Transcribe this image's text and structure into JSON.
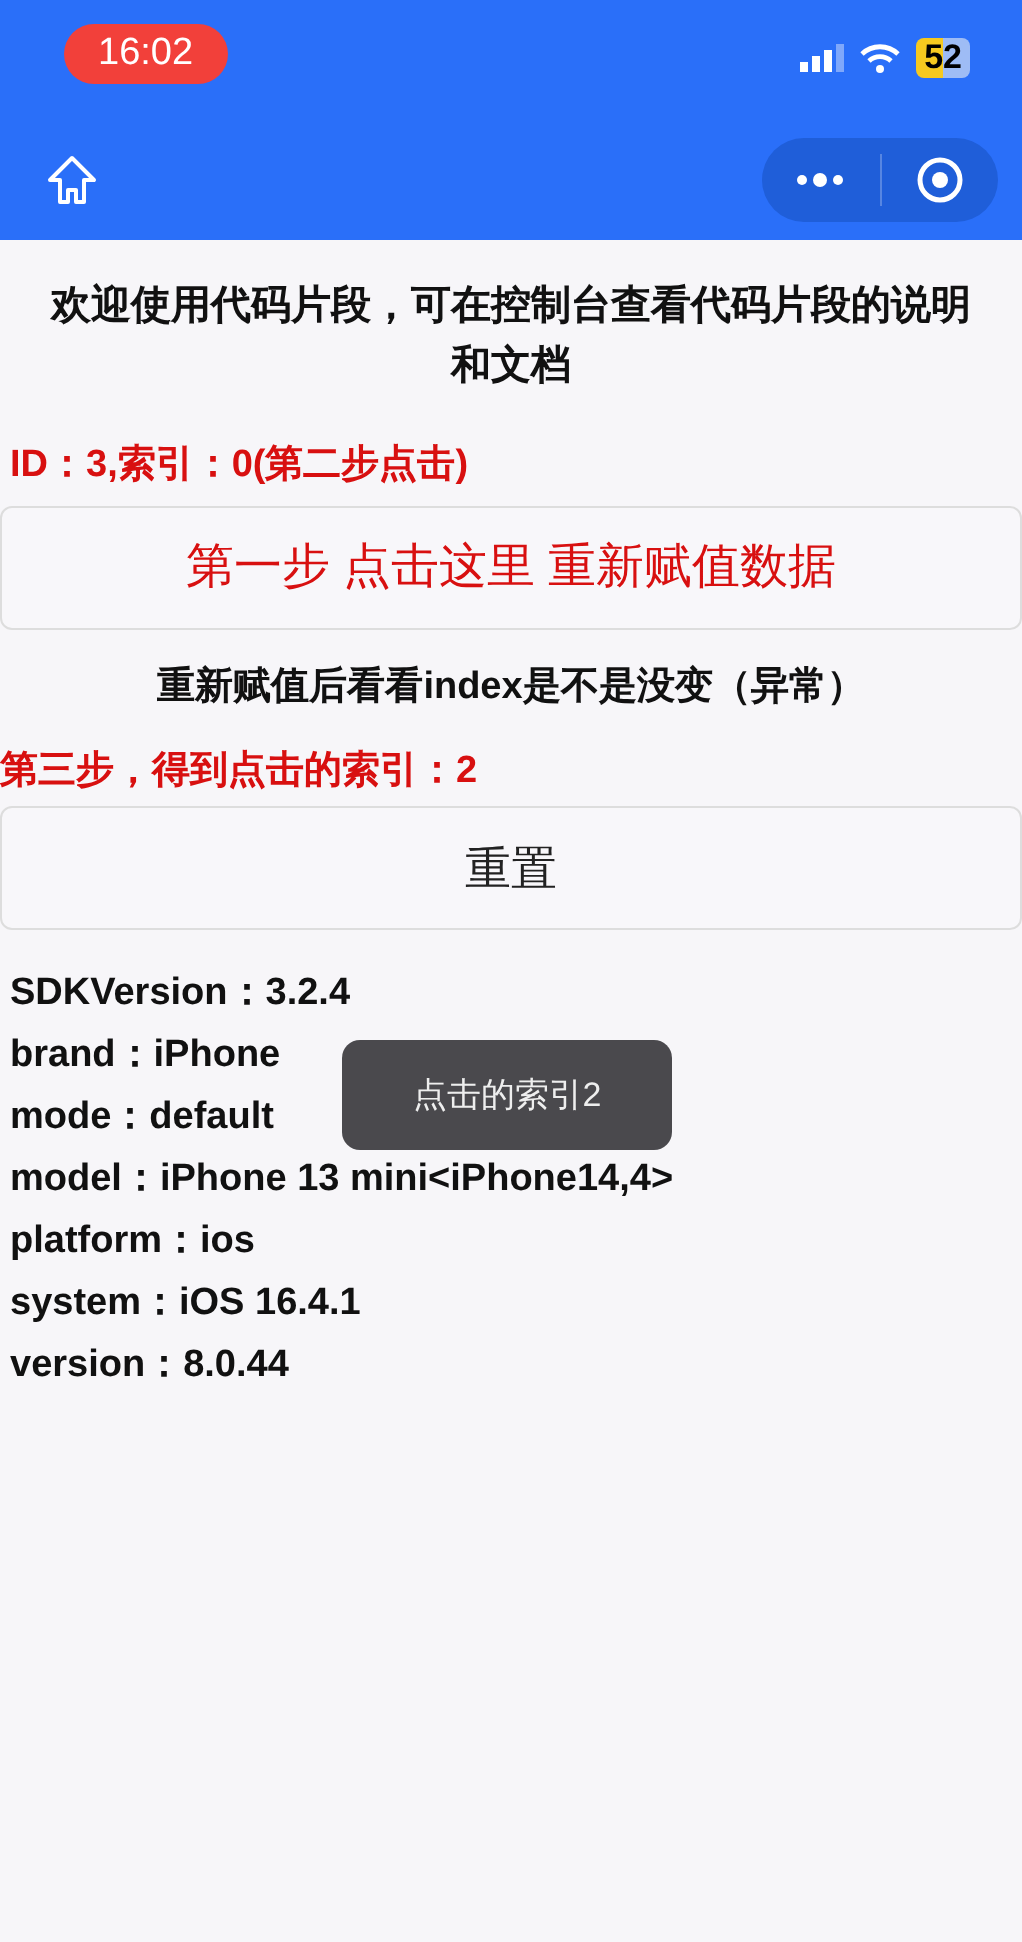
{
  "status_bar": {
    "time": "16:02",
    "battery": "52"
  },
  "intro": "欢迎使用代码片段，可在控制台查看代码片段的说明和文档",
  "id_line": "ID：3,索引：0(第二步点击)",
  "step1_button": "第一步 点击这里 重新赋值数据",
  "hint": "重新赋值后看看index是不是没变（异常）",
  "step3_line": "第三步，得到点击的索引：2",
  "reset_button": "重置",
  "info_lines": [
    "SDKVersion：3.2.4",
    "brand：iPhone",
    "mode：default",
    "model：iPhone 13 mini<iPhone14,4>",
    "platform：ios",
    "system：iOS 16.4.1",
    "version：8.0.44"
  ],
  "toast": "点击的索引2"
}
